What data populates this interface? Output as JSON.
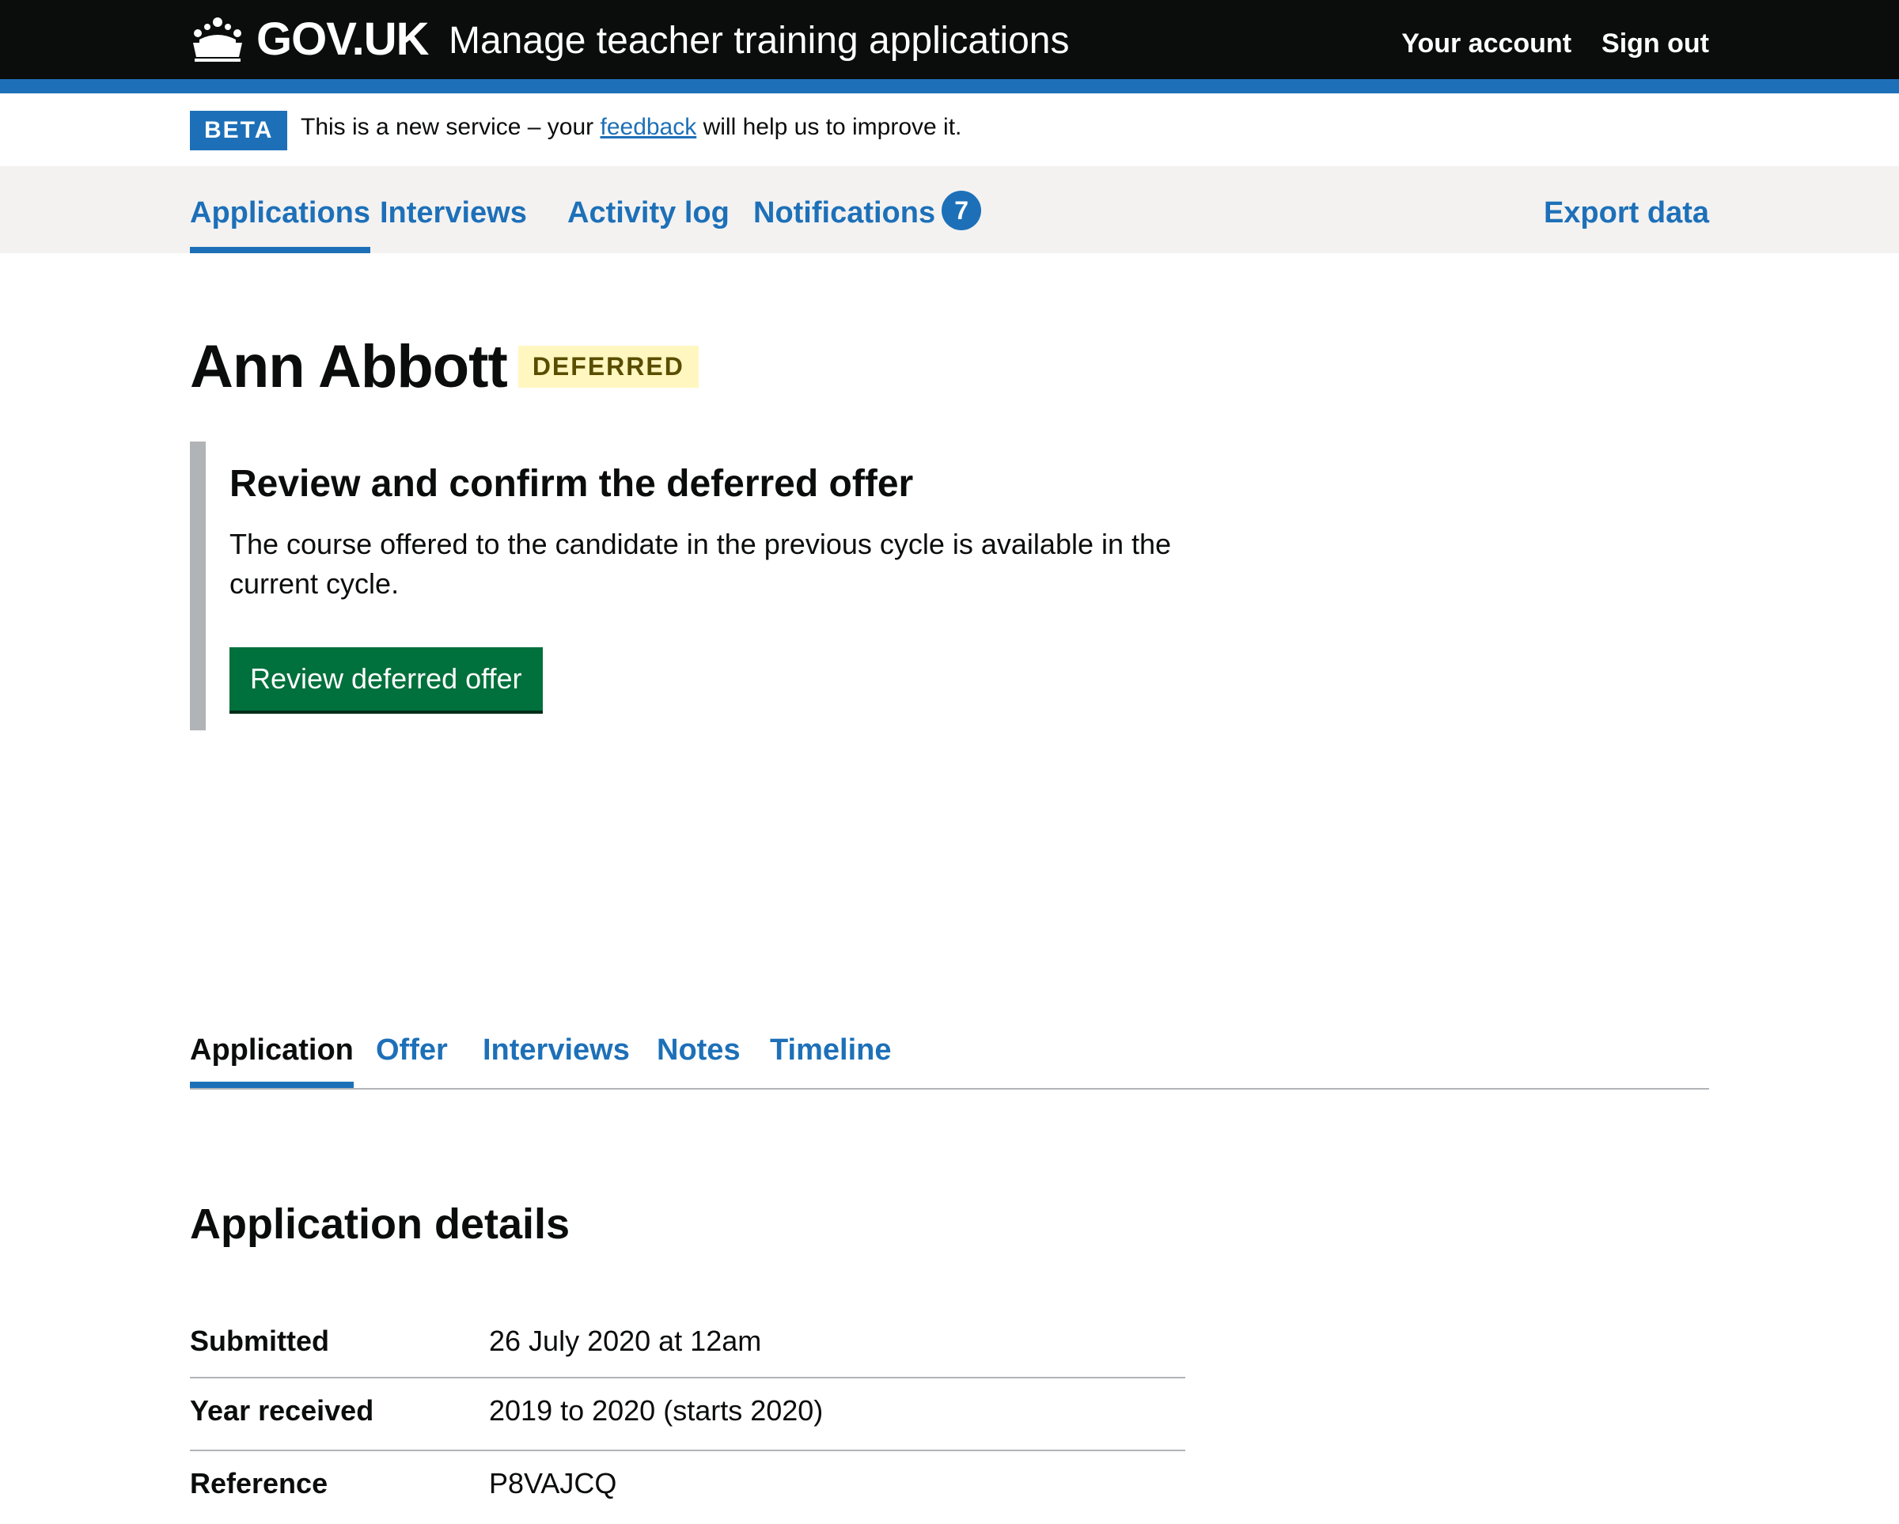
{
  "header": {
    "logo_text": "GOV.UK",
    "service_name": "Manage teacher training applications",
    "nav": [
      "Your account",
      "Sign out"
    ]
  },
  "phase_banner": {
    "tag": "BETA",
    "text_before": "This is a new service – your ",
    "link_text": "feedback",
    "text_after": " will help us to improve it."
  },
  "primary_nav": {
    "items": [
      "Applications",
      "Interviews",
      "Activity log",
      "Notifications"
    ],
    "notifications_count": "7",
    "export_label": "Export data",
    "current": "Applications"
  },
  "page": {
    "candidate_name": "Ann Abbott",
    "status_tag": "DEFERRED"
  },
  "inset": {
    "title": "Review and confirm the deferred offer",
    "body": "The course offered to the candidate in the previous cycle is available in the current cycle.",
    "button_label": "Review deferred offer"
  },
  "sub_nav": {
    "items": [
      "Application",
      "Offer",
      "Interviews",
      "Notes",
      "Timeline"
    ],
    "current": "Application"
  },
  "details": {
    "title": "Application details",
    "rows": [
      {
        "key": "Submitted",
        "value": "26 July 2020 at 12am"
      },
      {
        "key": "Year received",
        "value": "2019 to 2020 (starts 2020)"
      },
      {
        "key": "Reference",
        "value": "P8VAJCQ"
      }
    ]
  },
  "colors": {
    "brand_blue": "#1d70b8",
    "header_black": "#0b0c0c",
    "button_green": "#00703c",
    "tag_yellow_bg": "#fff7bf",
    "tag_yellow_text": "#594d00"
  }
}
